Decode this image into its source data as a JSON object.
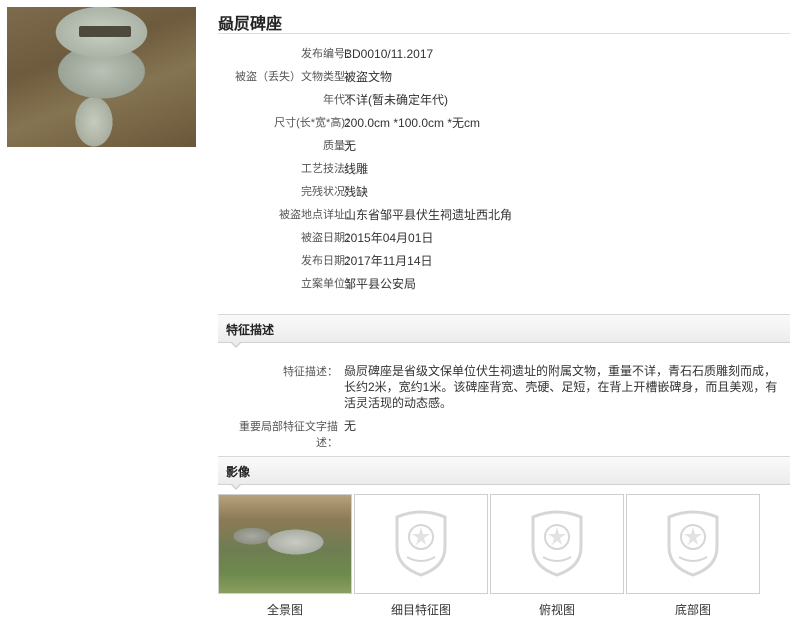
{
  "title": "赑屃碑座",
  "fields": [
    {
      "label": "发布编号：",
      "value": "BD0010/11.2017"
    },
    {
      "label": "被盗（丢失）文物类型：",
      "value": "被盗文物"
    },
    {
      "label": "年代：",
      "value": "不详(暂未确定年代)"
    },
    {
      "label": "尺寸(长*宽*高)：",
      "value": "200.0cm *100.0cm *无cm"
    },
    {
      "label": "质量：",
      "value": "无"
    },
    {
      "label": "工艺技法：",
      "value": "线雕"
    },
    {
      "label": "完残状况：",
      "value": "残缺"
    },
    {
      "label": "被盗地点详址：",
      "value": "山东省邹平县伏生祠遗址西北角"
    },
    {
      "label": "被盗日期：",
      "value": "2015年04月01日"
    },
    {
      "label": "发布日期：",
      "value": "2017年11月14日"
    },
    {
      "label": "立案单位：",
      "value": "邹平县公安局"
    }
  ],
  "features": {
    "heading": "特征描述",
    "desc_label": "特征描述：",
    "desc_value": "赑屃碑座是省级文保单位伏生祠遗址的附属文物，重量不详，青石石质雕刻而成，长约2米，宽约1米。该碑座背宽、壳硬、足短，在背上开槽嵌碑身，而且美观，有活灵活现的动态感。",
    "key_label": "重要局部特征文字描述：",
    "key_value": "无"
  },
  "images": {
    "heading": "影像",
    "items": [
      {
        "caption": "全景图",
        "kind": "photo"
      },
      {
        "caption": "细目特征图",
        "kind": "placeholder-emblem-icon"
      },
      {
        "caption": "俯视图",
        "kind": "placeholder-emblem-icon"
      },
      {
        "caption": "底部图",
        "kind": "placeholder-emblem-icon"
      }
    ]
  }
}
